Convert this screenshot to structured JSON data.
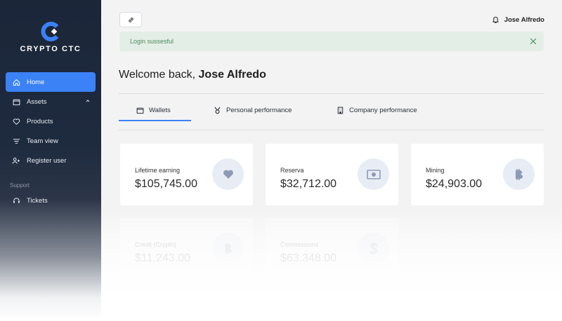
{
  "brand": {
    "name": "CRYPTO CTC"
  },
  "sidebar": {
    "items": [
      {
        "label": "Home",
        "icon": "home-icon",
        "active": true
      },
      {
        "label": "Assets",
        "icon": "wallet-icon"
      },
      {
        "label": "Products",
        "icon": "heart-icon"
      },
      {
        "label": "Team view",
        "icon": "filter-icon"
      },
      {
        "label": "Register user",
        "icon": "add-user-icon"
      }
    ],
    "support_label": "Support",
    "support_items": [
      {
        "label": "Tickets",
        "icon": "headset-icon"
      }
    ]
  },
  "header": {
    "user_name": "Jose Alfredo"
  },
  "alert": {
    "message": "Login sussesful"
  },
  "welcome": {
    "prefix": "Welcome back,",
    "name": "Jose Alfredo"
  },
  "tabs": [
    {
      "label": "Wallets",
      "icon": "wallet-icon",
      "active": true
    },
    {
      "label": "Personal performance",
      "icon": "medal-icon"
    },
    {
      "label": "Company performance",
      "icon": "building-icon"
    }
  ],
  "cards": [
    {
      "label": "Lifetime earning",
      "value": "$105,745.00",
      "icon": "heart-icon"
    },
    {
      "label": "Reserva",
      "value": "$32,712.00",
      "icon": "banknote-icon"
    },
    {
      "label": "Mining",
      "value": "$24,903.00",
      "icon": "bitcoin-icon"
    },
    {
      "label": "Credit (Crypto)",
      "value": "$11,243.00",
      "icon": "bitcoin-icon"
    },
    {
      "label": "Commissions",
      "value": "$63,348.00",
      "icon": "dollar-icon"
    }
  ],
  "colors": {
    "sidebar": "#1b2639",
    "accent": "#3b82f6",
    "alert_bg": "#e3eee6",
    "alert_text": "#4d8a5e",
    "icon_circle": "#e8edf5",
    "icon_fill": "#8e9bb5"
  }
}
